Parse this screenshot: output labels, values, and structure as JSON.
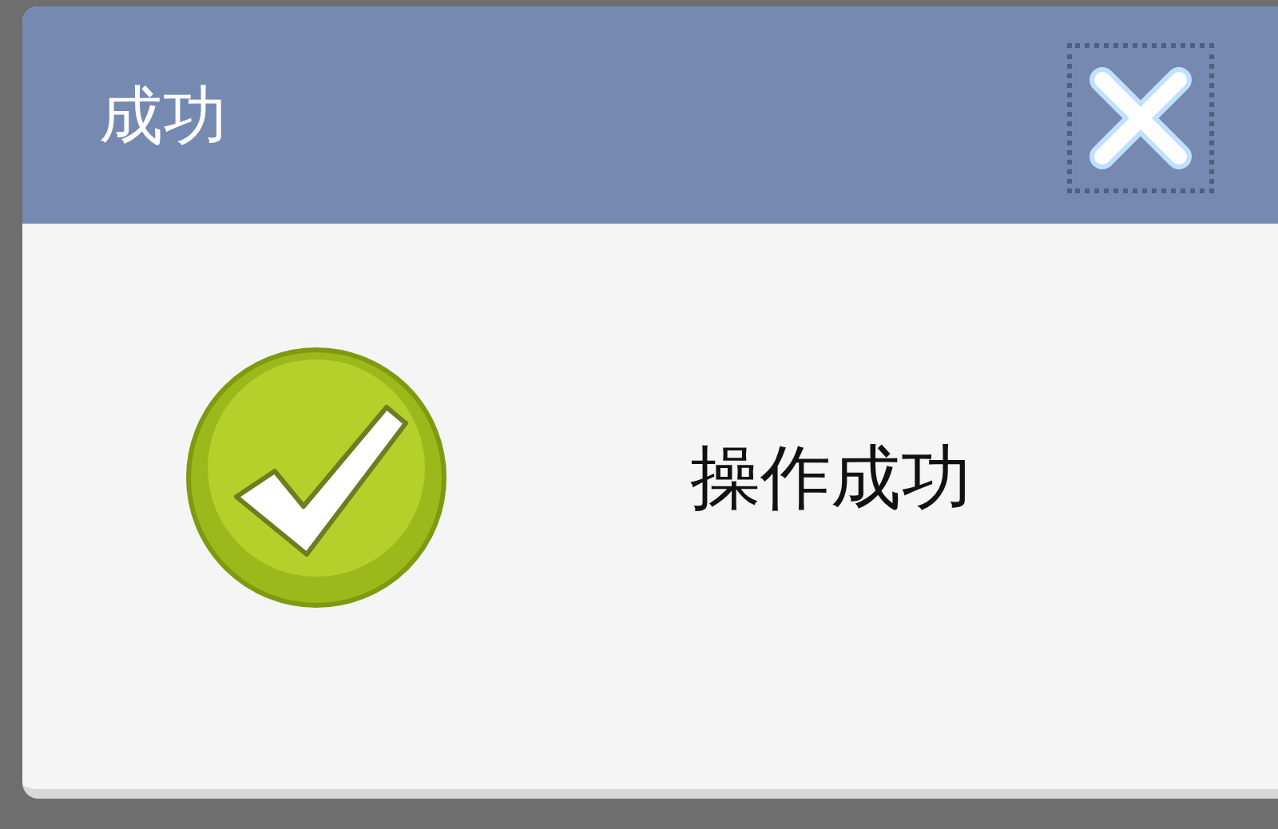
{
  "dialog": {
    "title": "成功",
    "message": "操作成功"
  }
}
